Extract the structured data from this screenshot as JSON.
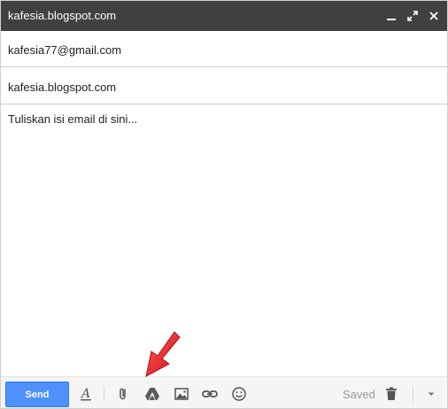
{
  "window": {
    "title": "kafesia.blogspot.com"
  },
  "compose": {
    "to_value": "kafesia77@gmail.com",
    "subject_value": "kafesia.blogspot.com",
    "body_placeholder": "Tuliskan isi email di sini..."
  },
  "toolbar": {
    "send_label": "Send",
    "status": "Saved",
    "icons": [
      "formatting-icon",
      "attach-icon",
      "drive-icon",
      "photo-icon",
      "link-icon",
      "emoji-icon",
      "trash-icon",
      "more-options-icon"
    ]
  },
  "colors": {
    "titlebar": "#404040",
    "send_button": "#4d90fe",
    "annotation_arrow": "#e8232b"
  }
}
